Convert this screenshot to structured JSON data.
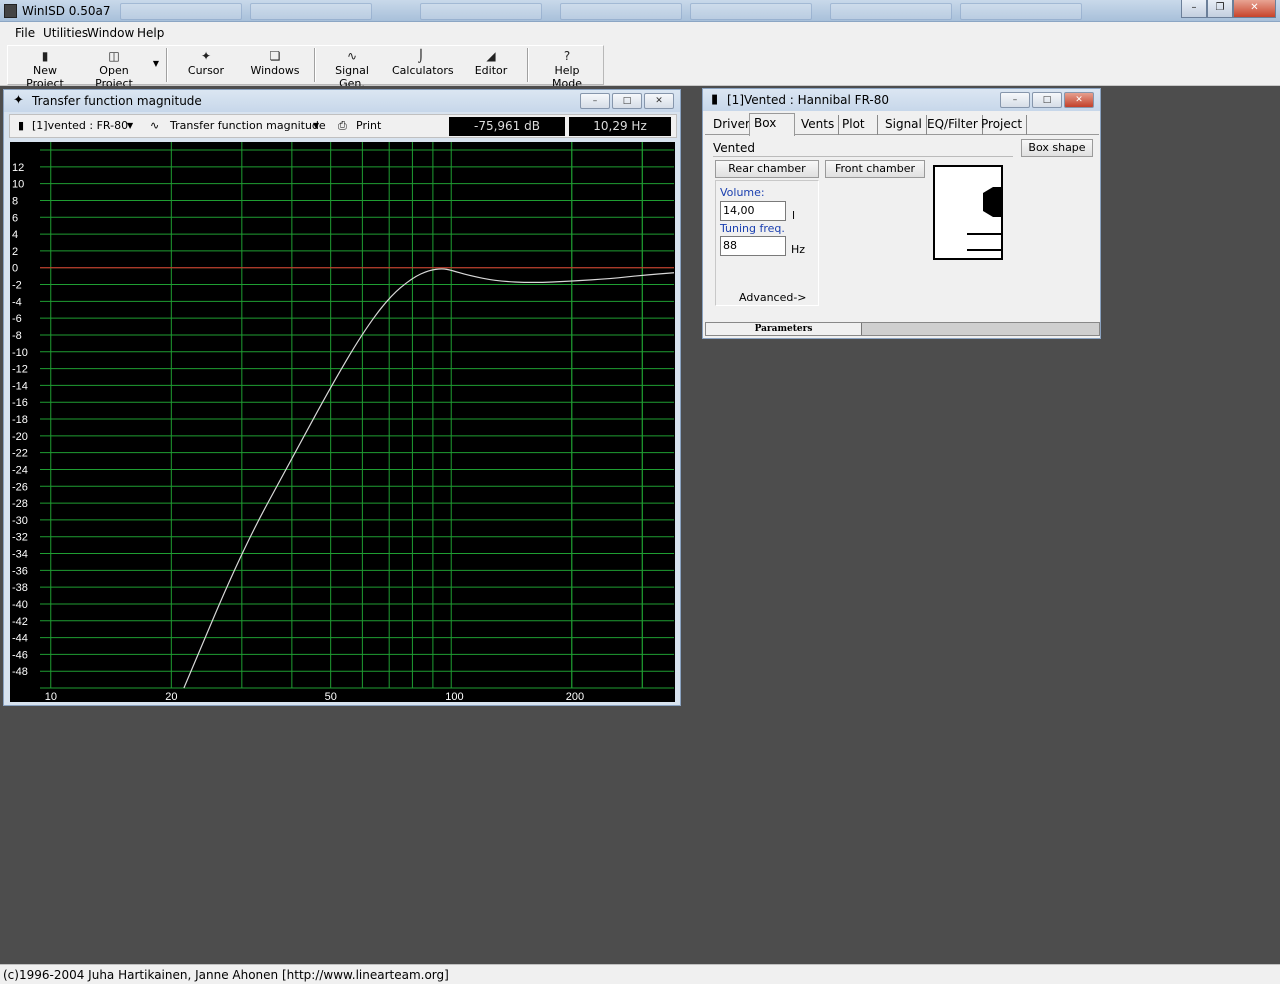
{
  "app": {
    "title": "WinISD 0.50a7"
  },
  "menu": {
    "file": "File",
    "utilities": "Utilities",
    "window": "Window",
    "help": "Help"
  },
  "toolbar": {
    "new_project": "New Project",
    "open_project": "Open Project",
    "cursor": "Cursor",
    "windows": "Windows",
    "signal_gen": "Signal Gen.",
    "calculators": "Calculators",
    "editor": "Editor",
    "help_mode": "Help Mode"
  },
  "graph_window": {
    "title": "Transfer function magnitude",
    "project_select": "[1]vented : FR-80",
    "plot_select": "Transfer function magnitude",
    "print_label": "Print",
    "cursor_db": "-75,961 dB",
    "cursor_hz": "10,29 Hz"
  },
  "project_window": {
    "title": "[1]Vented : Hannibal  FR-80",
    "tabs": [
      "Driver",
      "Box",
      "Vents",
      "Plot",
      "Signal",
      "EQ/Filter",
      "Project"
    ],
    "active_tab": "Box",
    "box_type": "Vented",
    "box_shape_button": "Box shape",
    "rear_chamber_button": "Rear chamber",
    "front_chamber_button": "Front chamber",
    "volume_label": "Volume:",
    "volume_value": "14,00",
    "volume_unit": "l",
    "tuning_label": "Tuning freq.",
    "tuning_value": "88",
    "tuning_unit": "Hz",
    "advanced_label": "Advanced->",
    "parameters_tab": "Parameters"
  },
  "status": {
    "text": "(c)1996-2004 Juha Hartikainen, Janne Ahonen [http://www.linearteam.org]"
  },
  "chart_data": {
    "type": "line",
    "title": "Transfer function magnitude",
    "xlabel": "",
    "ylabel": "",
    "x_scale": "log",
    "xlim": [
      9.4,
      360
    ],
    "ylim": [
      -50,
      14
    ],
    "x_ticks": [
      10,
      20,
      50,
      100,
      200
    ],
    "y_ticks": [
      12,
      10,
      8,
      6,
      4,
      2,
      0,
      -2,
      -4,
      -6,
      -8,
      -10,
      -12,
      -14,
      -16,
      -18,
      -20,
      -22,
      -24,
      -26,
      -28,
      -30,
      -32,
      -34,
      -36,
      -38,
      -40,
      -42,
      -44,
      -46,
      -48
    ],
    "grid": true,
    "reference_line_db": 0,
    "colors": {
      "background": "#000000",
      "grid": "#1f9e32",
      "curve": "#d8d8d8",
      "zero_line": "#e03030"
    },
    "series": [
      {
        "x": [
          21.5,
          30,
          40,
          50,
          60,
          70,
          80,
          88,
          95,
          100,
          110,
          130,
          160,
          200,
          250,
          300,
          360
        ],
        "y": [
          -50,
          -33.7,
          -22.7,
          -14.2,
          -7.8,
          -3.5,
          -1.2,
          -0.3,
          -0.1,
          -0.3,
          -0.9,
          -1.6,
          -1.8,
          -1.6,
          -1.3,
          -0.9,
          -0.6
        ]
      }
    ]
  }
}
